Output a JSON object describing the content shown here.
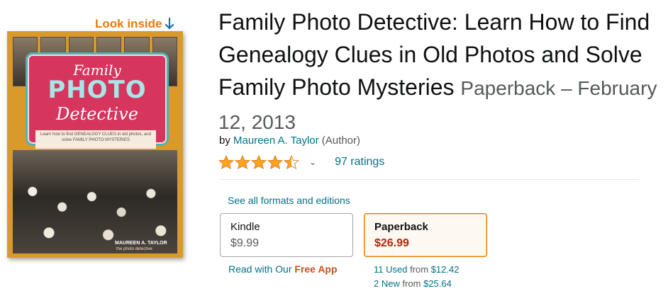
{
  "look_inside": {
    "label": "Look inside",
    "icon": "arrow-down-icon",
    "color": "#e47911"
  },
  "cover": {
    "title_word1": "Family",
    "title_word2": "PHOTO",
    "title_word3": "Detective",
    "tagline": "Learn how to find GENEALOGY CLUES in old photos, and solve FAMILY PHOTO MYSTERIES",
    "author": "MAUREEN A. TAYLOR",
    "imprint": "the photo detective"
  },
  "product": {
    "title": "Family Photo Detective: Learn How to Find Genealogy Clues in Old Photos and Solve Family Photo Mysteries",
    "format_date": "Paperback – February 12, 2013"
  },
  "byline": {
    "prefix": "by ",
    "author": "Maureen A. Taylor",
    "role": " (Author)"
  },
  "rating": {
    "stars": 4.5,
    "ratings_label": "97 ratings",
    "star_color": "#FFA41C"
  },
  "formats": {
    "see_all": "See all formats and editions",
    "options": [
      {
        "name": "Kindle",
        "price": "$9.99",
        "selected": false
      },
      {
        "name": "Paperback",
        "price": "$26.99",
        "selected": true
      }
    ],
    "kindle_note_prefix": "Read with Our ",
    "kindle_note_bold": "Free App",
    "used_count": "11 Used",
    "used_from": " from ",
    "used_price": "$12.42",
    "new_count": "2 New",
    "new_from": " from ",
    "new_price": "$25.64"
  },
  "colors": {
    "link": "#007185",
    "price_red": "#B12704",
    "selected_border": "#e77600"
  }
}
